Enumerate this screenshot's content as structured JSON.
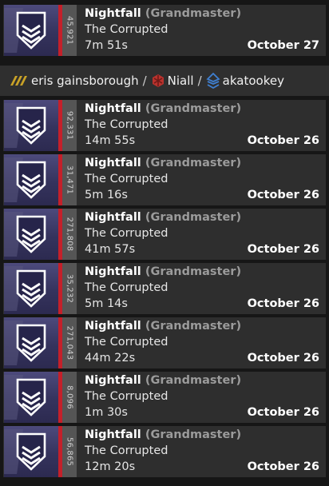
{
  "fireteam": {
    "separator": "/",
    "members": [
      {
        "name": "eris gainsborough",
        "icon": "hunter-class-icon"
      },
      {
        "name": "Niall",
        "icon": "titan-class-icon"
      },
      {
        "name": "akatookey",
        "icon": "warlock-class-icon"
      }
    ]
  },
  "activities": [
    {
      "stat": "45,921",
      "mode": "Nightfall",
      "difficulty": "(Grandmaster)",
      "name": "The Corrupted",
      "duration": "7m 51s",
      "date": "October 27"
    },
    {
      "stat": "92,331",
      "mode": "Nightfall",
      "difficulty": "(Grandmaster)",
      "name": "The Corrupted",
      "duration": "14m 55s",
      "date": "October 26"
    },
    {
      "stat": "31,471",
      "mode": "Nightfall",
      "difficulty": "(Grandmaster)",
      "name": "The Corrupted",
      "duration": "5m 16s",
      "date": "October 26"
    },
    {
      "stat": "271,808",
      "mode": "Nightfall",
      "difficulty": "(Grandmaster)",
      "name": "The Corrupted",
      "duration": "41m 57s",
      "date": "October 26"
    },
    {
      "stat": "35,232",
      "mode": "Nightfall",
      "difficulty": "(Grandmaster)",
      "name": "The Corrupted",
      "duration": "5m 14s",
      "date": "October 26"
    },
    {
      "stat": "271,043",
      "mode": "Nightfall",
      "difficulty": "(Grandmaster)",
      "name": "The Corrupted",
      "duration": "44m 22s",
      "date": "October 26"
    },
    {
      "stat": "8,096",
      "mode": "Nightfall",
      "difficulty": "(Grandmaster)",
      "name": "The Corrupted",
      "duration": "1m 30s",
      "date": "October 26"
    },
    {
      "stat": "56,865",
      "mode": "Nightfall",
      "difficulty": "(Grandmaster)",
      "name": "The Corrupted",
      "duration": "12m 20s",
      "date": "October 26"
    }
  ],
  "colors": {
    "accent_bar": "#c4202a",
    "hunter_icon": "#c9a227",
    "titan_icon": "#b8322d",
    "warlock_icon": "#3f7fd0"
  }
}
